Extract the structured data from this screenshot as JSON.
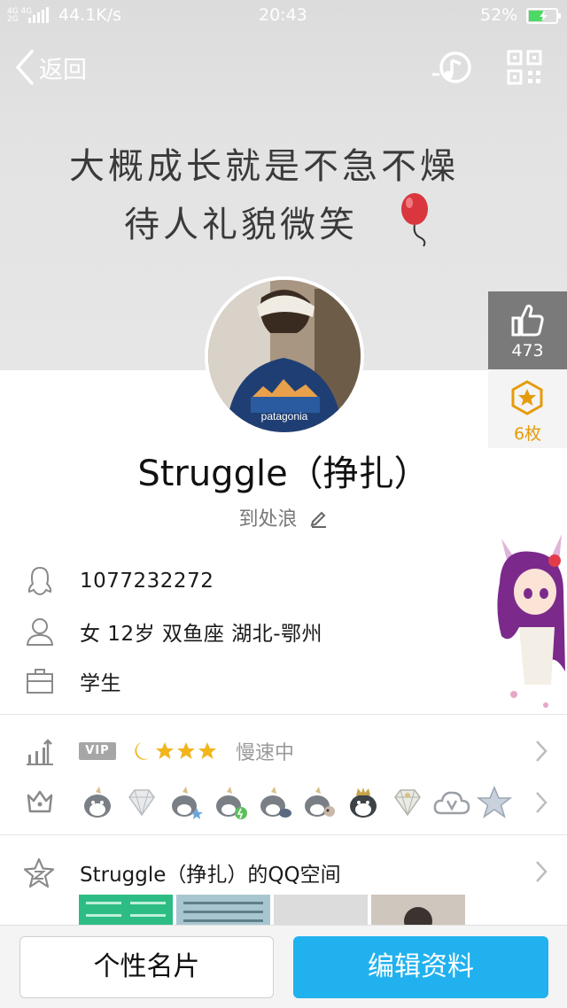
{
  "status_bar": {
    "network_type": "4G 4G\n2G",
    "speed": "44.1K/s",
    "time": "20:43",
    "battery_percent": "52%",
    "battery_level": 0.52
  },
  "header": {
    "back_label": "返回",
    "music_icon": "music-note-icon",
    "qr_icon": "qr-code-icon"
  },
  "cover": {
    "line1": "大概成长就是不急不燥",
    "line2": "待人礼貌微笑"
  },
  "side_panel": {
    "like_count": "473",
    "medal_count": "6枚"
  },
  "profile": {
    "nickname": "Struggle（挣扎）",
    "signature": "到处浪"
  },
  "info": {
    "qq_number": "1077232272",
    "basic": "女  12岁  双鱼座  湖北-鄂州",
    "occupation": "学生"
  },
  "vip": {
    "badge": "VIP",
    "status": "慢速中"
  },
  "qzone": {
    "title": "Struggle（挣扎）的QQ空间"
  },
  "buttons": {
    "card": "个性名片",
    "edit": "编辑资料"
  },
  "colors": {
    "primary": "#21b1ee",
    "medal": "#e59c0b",
    "like_bg": "#7a7a7a"
  }
}
